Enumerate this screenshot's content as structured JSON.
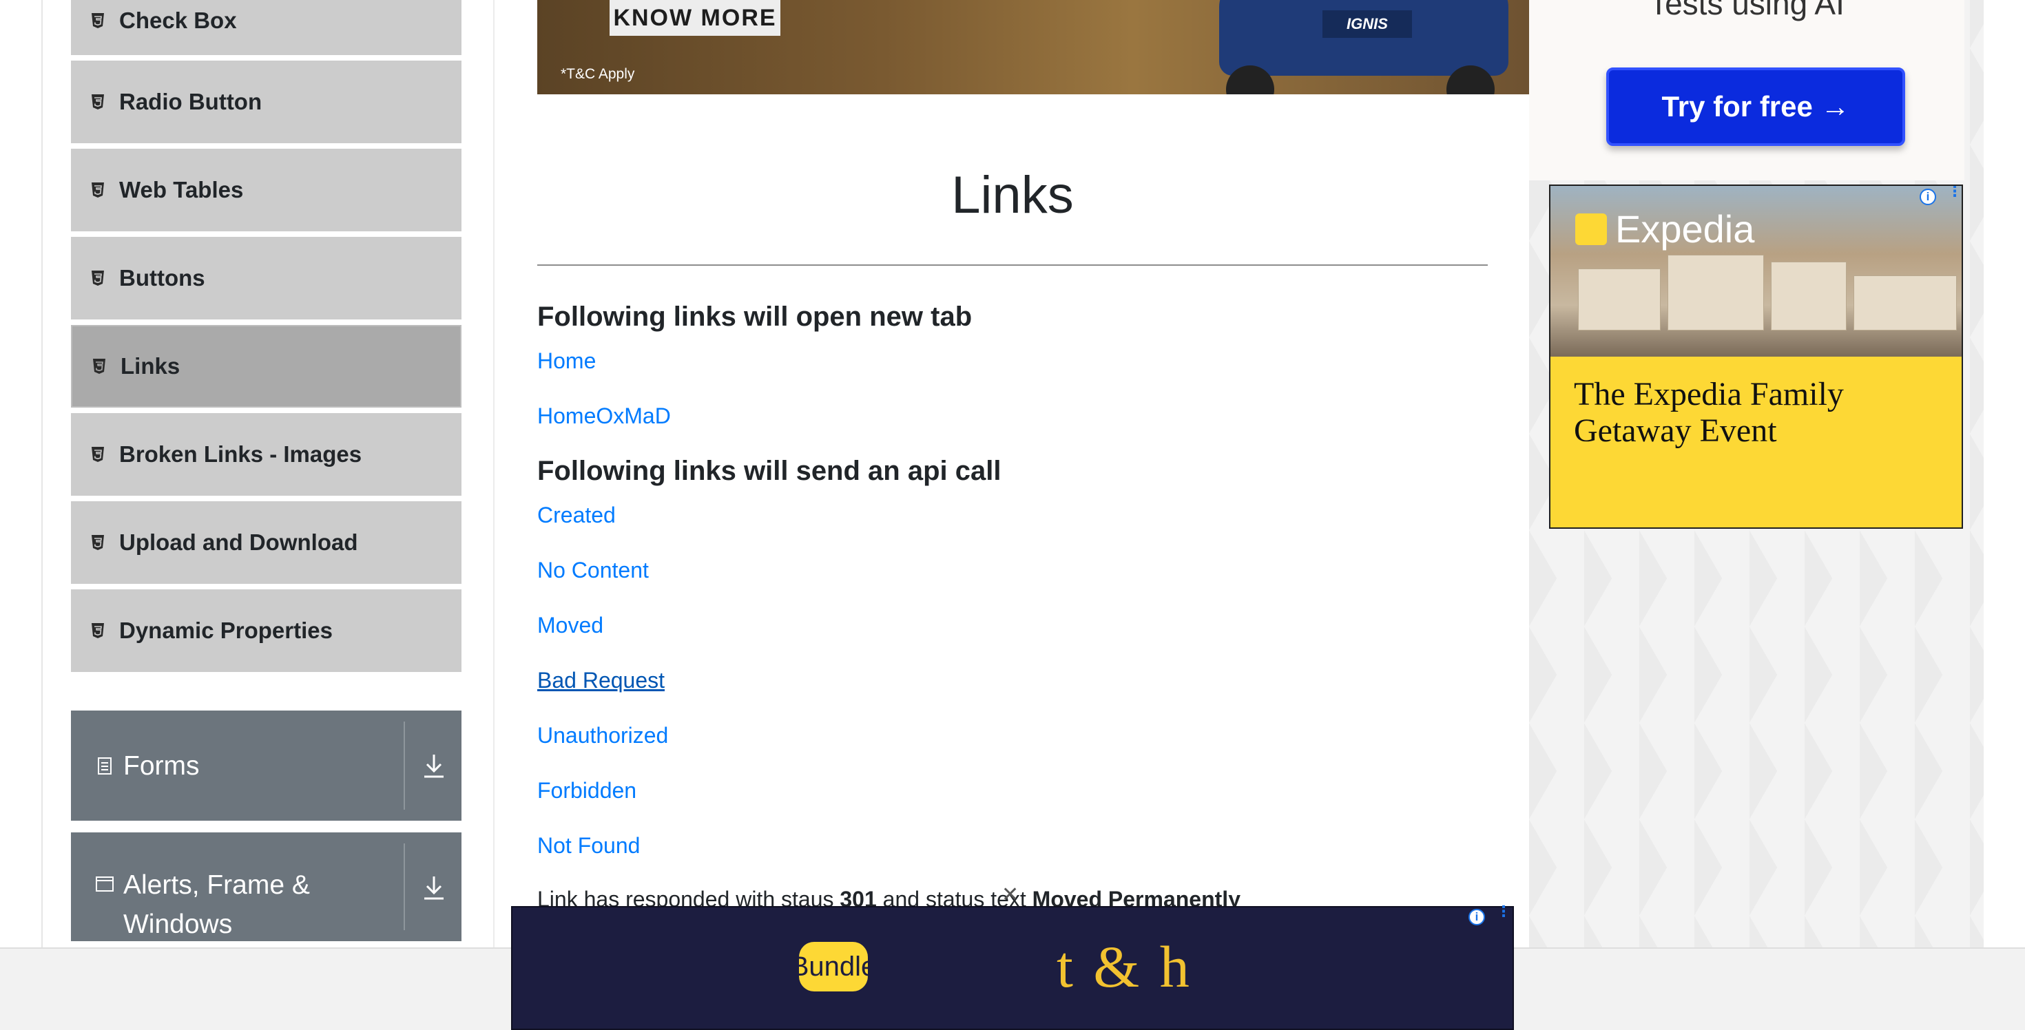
{
  "sidebar": {
    "items": [
      {
        "label": "Check Box",
        "icon": "html5-badge-icon"
      },
      {
        "label": "Radio Button",
        "icon": "html5-badge-icon"
      },
      {
        "label": "Web Tables",
        "icon": "html5-badge-icon"
      },
      {
        "label": "Buttons",
        "icon": "html5-badge-icon"
      },
      {
        "label": "Links",
        "icon": "html5-badge-icon",
        "active": true
      },
      {
        "label": "Broken Links - Images",
        "icon": "html5-badge-icon"
      },
      {
        "label": "Upload and Download",
        "icon": "html5-badge-icon"
      },
      {
        "label": "Dynamic Properties",
        "icon": "html5-badge-icon"
      }
    ],
    "groups": [
      {
        "label": "Forms",
        "icon": "document-icon"
      },
      {
        "label": "Alerts, Frame & Windows",
        "line1": "Alerts, Frame &",
        "line2": "Windows",
        "icon": "window-icon"
      }
    ]
  },
  "top_banner": {
    "cta": "KNOW MORE",
    "fine_print": "*T&C Apply",
    "car_badge": "IGNIS"
  },
  "main": {
    "title": "Links",
    "sections": [
      {
        "heading": "Following links will open new tab",
        "links": [
          "Home",
          "HomeOxMaD"
        ]
      },
      {
        "heading": "Following links will send an api call",
        "links": [
          "Created",
          "No Content",
          "Moved",
          "Bad Request",
          "Unauthorized",
          "Forbidden",
          "Not Found"
        ]
      }
    ],
    "response": {
      "prefix": "Link has responded with staus",
      "code": "301",
      "middle": "and status text",
      "status_text": "Moved Permanently"
    }
  },
  "right_ads": {
    "ai_card": {
      "text": "Tests using AI",
      "button": "Try for free →"
    },
    "expedia": {
      "brand": "Expedia",
      "headline": "The Expedia Family Getaway Event"
    }
  },
  "bottom_ad": {
    "pill_text": "Bundle",
    "brand": "t & h"
  },
  "colors": {
    "link": "#007bff",
    "sidebar_item": "#cccccc",
    "sidebar_active": "#aaaaaa",
    "group_bg": "#6c757d",
    "cta_blue": "#0b2bde",
    "expedia_yellow": "#fdd835",
    "bottom_ad_bg": "#1c1d40"
  }
}
